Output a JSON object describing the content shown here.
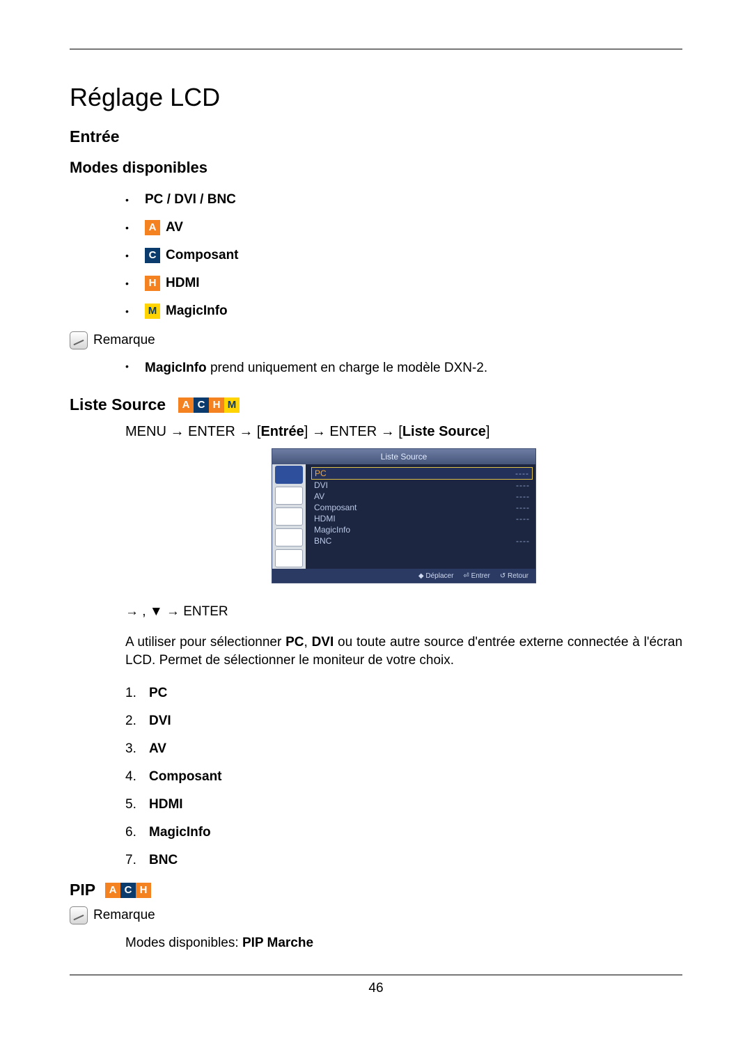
{
  "title": "Réglage LCD",
  "section_entree": "Entrée",
  "modes_heading": "Modes disponibles",
  "modes": {
    "pc": "PC / DVI / BNC",
    "av": "AV",
    "composant": "Composant",
    "hdmi": "HDMI",
    "magicinfo": "MagicInfo"
  },
  "badges": {
    "a": "A",
    "c": "C",
    "h": "H",
    "m": "M"
  },
  "note_label": "Remarque",
  "note_text_prefix": "MagicInfo",
  "note_text_rest": " prend uniquement en charge le modèle DXN-2.",
  "liste_source_heading": "Liste Source",
  "menupath": {
    "p1": "MENU → ENTER → [",
    "b1": "Entrée",
    "p2": "] → ENTER → [",
    "b2": "Liste Source",
    "p3": "]"
  },
  "osd": {
    "title": "Liste Source",
    "rows": [
      {
        "label": "PC",
        "value": "----",
        "sel": true
      },
      {
        "label": "DVI",
        "value": "----"
      },
      {
        "label": "AV",
        "value": "----"
      },
      {
        "label": "Composant",
        "value": "----"
      },
      {
        "label": "HDMI",
        "value": "----"
      },
      {
        "label": "MagicInfo",
        "value": ""
      },
      {
        "label": "BNC",
        "value": "----"
      }
    ],
    "foot": {
      "move": "Déplacer",
      "enter": "Entrer",
      "return": "Retour"
    }
  },
  "post_arrow": "→   , ▼ → ENTER",
  "para_prefix": "A utiliser pour sélectionner ",
  "para_pc": "PC",
  "para_sep": ", ",
  "para_dvi": "DVI",
  "para_rest": " ou toute autre source d'entrée externe connectée à l'écran LCD. Permet de sélectionner le moniteur de votre choix.",
  "numlist": [
    "PC",
    "DVI",
    "AV",
    "Composant",
    "HDMI",
    "MagicInfo",
    "BNC"
  ],
  "pip_heading": "PIP",
  "modes_line_prefix": "Modes disponibles: ",
  "modes_line_bold": "PIP Marche",
  "page_number": "46"
}
